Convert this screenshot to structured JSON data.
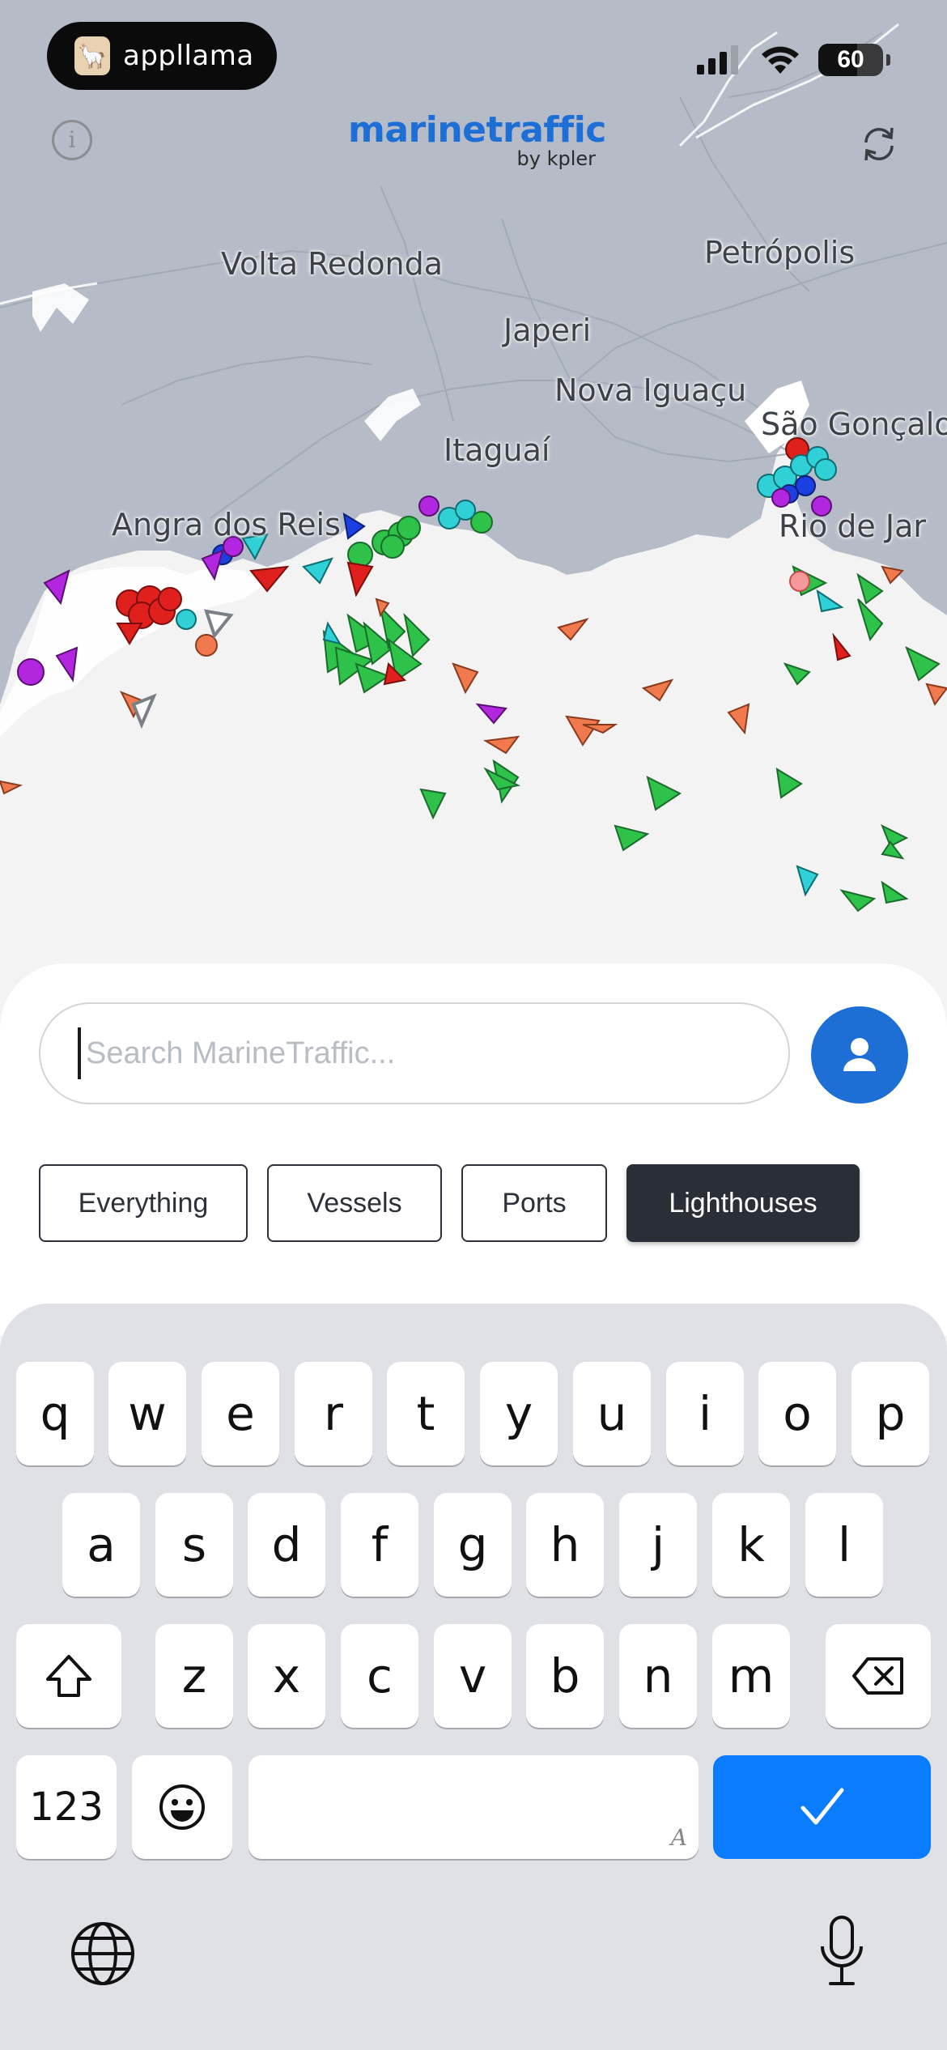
{
  "status_bar": {
    "app_badge": "appllama",
    "battery_level": "60",
    "battery_fraction": 0.6,
    "icons": [
      "signal-icon",
      "wifi-icon",
      "battery-icon"
    ]
  },
  "header": {
    "logo_text": "marinetraffic",
    "logo_sub": "by kpler",
    "info_icon": "info-icon",
    "refresh_icon": "refresh-icon"
  },
  "map": {
    "cities": [
      "Volta Redonda",
      "Petrópolis",
      "Japeri",
      "Nova Iguaçu",
      "São Gonçalo",
      "Itaguaí",
      "Angra dos Reis",
      "Rio de Jar"
    ],
    "colors": {
      "land": "#b5bcc7",
      "sea": "#f3f3f4",
      "cargo": "#2ec24a",
      "tanker": "#e0201c",
      "passenger": "#1b3fe0",
      "tug": "#2fd0d6",
      "fishing": "#f07a4e",
      "pleasure": "#b326e0",
      "other": "#8a8d92"
    }
  },
  "search": {
    "placeholder": "Search MarineTraffic...",
    "value": "",
    "user_icon": "user-icon",
    "accent": "#1d6fd6"
  },
  "filters": [
    {
      "label": "Everything",
      "active": false
    },
    {
      "label": "Vessels",
      "active": false
    },
    {
      "label": "Ports",
      "active": false
    },
    {
      "label": "Lighthouses",
      "active": true
    }
  ],
  "keyboard": {
    "row1": [
      "q",
      "w",
      "e",
      "r",
      "t",
      "y",
      "u",
      "i",
      "o",
      "p"
    ],
    "row2": [
      "a",
      "s",
      "d",
      "f",
      "g",
      "h",
      "j",
      "k",
      "l"
    ],
    "row3": [
      "z",
      "x",
      "c",
      "v",
      "b",
      "n",
      "m"
    ],
    "numbers_key": "123",
    "space_hint": "A",
    "icons": [
      "shift-icon",
      "backspace-icon",
      "emoji-icon",
      "checkmark-icon",
      "globe-icon",
      "microphone-icon"
    ],
    "accent": "#0a7cff"
  }
}
